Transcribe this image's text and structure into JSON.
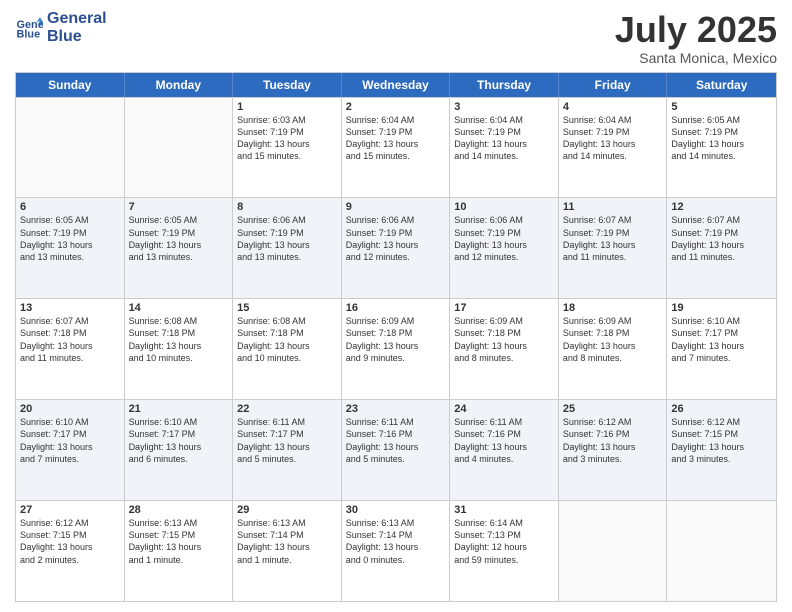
{
  "header": {
    "logo_line1": "General",
    "logo_line2": "Blue",
    "month": "July 2025",
    "location": "Santa Monica, Mexico"
  },
  "days_of_week": [
    "Sunday",
    "Monday",
    "Tuesday",
    "Wednesday",
    "Thursday",
    "Friday",
    "Saturday"
  ],
  "rows": [
    [
      {
        "day": "",
        "lines": []
      },
      {
        "day": "",
        "lines": []
      },
      {
        "day": "1",
        "lines": [
          "Sunrise: 6:03 AM",
          "Sunset: 7:19 PM",
          "Daylight: 13 hours",
          "and 15 minutes."
        ]
      },
      {
        "day": "2",
        "lines": [
          "Sunrise: 6:04 AM",
          "Sunset: 7:19 PM",
          "Daylight: 13 hours",
          "and 15 minutes."
        ]
      },
      {
        "day": "3",
        "lines": [
          "Sunrise: 6:04 AM",
          "Sunset: 7:19 PM",
          "Daylight: 13 hours",
          "and 14 minutes."
        ]
      },
      {
        "day": "4",
        "lines": [
          "Sunrise: 6:04 AM",
          "Sunset: 7:19 PM",
          "Daylight: 13 hours",
          "and 14 minutes."
        ]
      },
      {
        "day": "5",
        "lines": [
          "Sunrise: 6:05 AM",
          "Sunset: 7:19 PM",
          "Daylight: 13 hours",
          "and 14 minutes."
        ]
      }
    ],
    [
      {
        "day": "6",
        "lines": [
          "Sunrise: 6:05 AM",
          "Sunset: 7:19 PM",
          "Daylight: 13 hours",
          "and 13 minutes."
        ]
      },
      {
        "day": "7",
        "lines": [
          "Sunrise: 6:05 AM",
          "Sunset: 7:19 PM",
          "Daylight: 13 hours",
          "and 13 minutes."
        ]
      },
      {
        "day": "8",
        "lines": [
          "Sunrise: 6:06 AM",
          "Sunset: 7:19 PM",
          "Daylight: 13 hours",
          "and 13 minutes."
        ]
      },
      {
        "day": "9",
        "lines": [
          "Sunrise: 6:06 AM",
          "Sunset: 7:19 PM",
          "Daylight: 13 hours",
          "and 12 minutes."
        ]
      },
      {
        "day": "10",
        "lines": [
          "Sunrise: 6:06 AM",
          "Sunset: 7:19 PM",
          "Daylight: 13 hours",
          "and 12 minutes."
        ]
      },
      {
        "day": "11",
        "lines": [
          "Sunrise: 6:07 AM",
          "Sunset: 7:19 PM",
          "Daylight: 13 hours",
          "and 11 minutes."
        ]
      },
      {
        "day": "12",
        "lines": [
          "Sunrise: 6:07 AM",
          "Sunset: 7:19 PM",
          "Daylight: 13 hours",
          "and 11 minutes."
        ]
      }
    ],
    [
      {
        "day": "13",
        "lines": [
          "Sunrise: 6:07 AM",
          "Sunset: 7:18 PM",
          "Daylight: 13 hours",
          "and 11 minutes."
        ]
      },
      {
        "day": "14",
        "lines": [
          "Sunrise: 6:08 AM",
          "Sunset: 7:18 PM",
          "Daylight: 13 hours",
          "and 10 minutes."
        ]
      },
      {
        "day": "15",
        "lines": [
          "Sunrise: 6:08 AM",
          "Sunset: 7:18 PM",
          "Daylight: 13 hours",
          "and 10 minutes."
        ]
      },
      {
        "day": "16",
        "lines": [
          "Sunrise: 6:09 AM",
          "Sunset: 7:18 PM",
          "Daylight: 13 hours",
          "and 9 minutes."
        ]
      },
      {
        "day": "17",
        "lines": [
          "Sunrise: 6:09 AM",
          "Sunset: 7:18 PM",
          "Daylight: 13 hours",
          "and 8 minutes."
        ]
      },
      {
        "day": "18",
        "lines": [
          "Sunrise: 6:09 AM",
          "Sunset: 7:18 PM",
          "Daylight: 13 hours",
          "and 8 minutes."
        ]
      },
      {
        "day": "19",
        "lines": [
          "Sunrise: 6:10 AM",
          "Sunset: 7:17 PM",
          "Daylight: 13 hours",
          "and 7 minutes."
        ]
      }
    ],
    [
      {
        "day": "20",
        "lines": [
          "Sunrise: 6:10 AM",
          "Sunset: 7:17 PM",
          "Daylight: 13 hours",
          "and 7 minutes."
        ]
      },
      {
        "day": "21",
        "lines": [
          "Sunrise: 6:10 AM",
          "Sunset: 7:17 PM",
          "Daylight: 13 hours",
          "and 6 minutes."
        ]
      },
      {
        "day": "22",
        "lines": [
          "Sunrise: 6:11 AM",
          "Sunset: 7:17 PM",
          "Daylight: 13 hours",
          "and 5 minutes."
        ]
      },
      {
        "day": "23",
        "lines": [
          "Sunrise: 6:11 AM",
          "Sunset: 7:16 PM",
          "Daylight: 13 hours",
          "and 5 minutes."
        ]
      },
      {
        "day": "24",
        "lines": [
          "Sunrise: 6:11 AM",
          "Sunset: 7:16 PM",
          "Daylight: 13 hours",
          "and 4 minutes."
        ]
      },
      {
        "day": "25",
        "lines": [
          "Sunrise: 6:12 AM",
          "Sunset: 7:16 PM",
          "Daylight: 13 hours",
          "and 3 minutes."
        ]
      },
      {
        "day": "26",
        "lines": [
          "Sunrise: 6:12 AM",
          "Sunset: 7:15 PM",
          "Daylight: 13 hours",
          "and 3 minutes."
        ]
      }
    ],
    [
      {
        "day": "27",
        "lines": [
          "Sunrise: 6:12 AM",
          "Sunset: 7:15 PM",
          "Daylight: 13 hours",
          "and 2 minutes."
        ]
      },
      {
        "day": "28",
        "lines": [
          "Sunrise: 6:13 AM",
          "Sunset: 7:15 PM",
          "Daylight: 13 hours",
          "and 1 minute."
        ]
      },
      {
        "day": "29",
        "lines": [
          "Sunrise: 6:13 AM",
          "Sunset: 7:14 PM",
          "Daylight: 13 hours",
          "and 1 minute."
        ]
      },
      {
        "day": "30",
        "lines": [
          "Sunrise: 6:13 AM",
          "Sunset: 7:14 PM",
          "Daylight: 13 hours",
          "and 0 minutes."
        ]
      },
      {
        "day": "31",
        "lines": [
          "Sunrise: 6:14 AM",
          "Sunset: 7:13 PM",
          "Daylight: 12 hours",
          "and 59 minutes."
        ]
      },
      {
        "day": "",
        "lines": []
      },
      {
        "day": "",
        "lines": []
      }
    ]
  ]
}
